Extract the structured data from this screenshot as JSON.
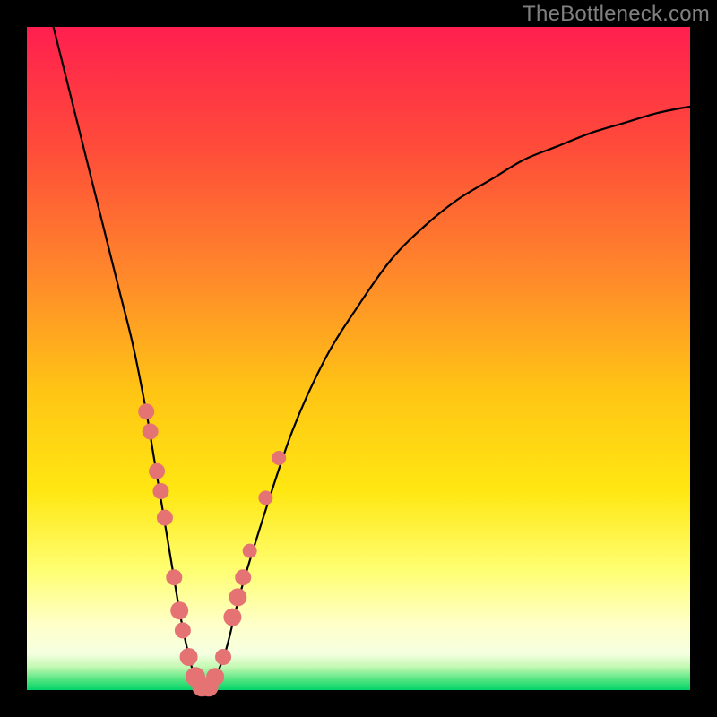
{
  "watermark": "TheBottleneck.com",
  "colors": {
    "frame": "#000000",
    "curve": "#000000",
    "dot_fill": "#e57373",
    "dot_stroke": "#c05858",
    "gradient_stops": [
      {
        "offset": 0.0,
        "color": "#ff1f4f"
      },
      {
        "offset": 0.18,
        "color": "#ff4b3a"
      },
      {
        "offset": 0.38,
        "color": "#ff8a2a"
      },
      {
        "offset": 0.55,
        "color": "#ffc514"
      },
      {
        "offset": 0.7,
        "color": "#ffe712"
      },
      {
        "offset": 0.82,
        "color": "#ffff73"
      },
      {
        "offset": 0.9,
        "color": "#ffffc8"
      },
      {
        "offset": 0.945,
        "color": "#f5ffe0"
      },
      {
        "offset": 0.965,
        "color": "#c3f9b3"
      },
      {
        "offset": 0.985,
        "color": "#4fe47e"
      },
      {
        "offset": 1.0,
        "color": "#00d46a"
      }
    ]
  },
  "chart_data": {
    "type": "line",
    "title": "",
    "xlabel": "",
    "ylabel": "",
    "xlim": [
      0,
      100
    ],
    "ylim": [
      0,
      100
    ],
    "series": [
      {
        "name": "bottleneck-curve",
        "x": [
          4,
          6,
          8,
          10,
          12,
          14,
          16,
          18,
          19,
          20,
          21,
          22,
          23,
          24,
          25,
          26,
          27,
          28,
          30,
          32,
          35,
          40,
          45,
          50,
          55,
          60,
          65,
          70,
          75,
          80,
          85,
          90,
          95,
          100
        ],
        "y": [
          100,
          92,
          84,
          76,
          68,
          60,
          52,
          42,
          36,
          30,
          24,
          18,
          12,
          7,
          3,
          1,
          0,
          1,
          6,
          14,
          24,
          39,
          50,
          58,
          65,
          70,
          74,
          77,
          80,
          82,
          84,
          85.5,
          87,
          88
        ]
      }
    ],
    "markers": [
      {
        "x": 18.0,
        "y": 42,
        "r": 9
      },
      {
        "x": 18.6,
        "y": 39,
        "r": 9
      },
      {
        "x": 19.6,
        "y": 33,
        "r": 9
      },
      {
        "x": 20.2,
        "y": 30,
        "r": 9
      },
      {
        "x": 20.8,
        "y": 26,
        "r": 9
      },
      {
        "x": 22.2,
        "y": 17,
        "r": 9
      },
      {
        "x": 23.0,
        "y": 12,
        "r": 10
      },
      {
        "x": 23.5,
        "y": 9,
        "r": 9
      },
      {
        "x": 24.4,
        "y": 5,
        "r": 10
      },
      {
        "x": 25.4,
        "y": 2,
        "r": 11
      },
      {
        "x": 26.4,
        "y": 0.5,
        "r": 11
      },
      {
        "x": 27.4,
        "y": 0.5,
        "r": 11
      },
      {
        "x": 28.4,
        "y": 2,
        "r": 10
      },
      {
        "x": 29.6,
        "y": 5,
        "r": 9
      },
      {
        "x": 31.0,
        "y": 11,
        "r": 10
      },
      {
        "x": 31.8,
        "y": 14,
        "r": 10
      },
      {
        "x": 32.6,
        "y": 17,
        "r": 9
      },
      {
        "x": 33.6,
        "y": 21,
        "r": 8
      },
      {
        "x": 36.0,
        "y": 29,
        "r": 8
      },
      {
        "x": 38.0,
        "y": 35,
        "r": 8
      }
    ]
  }
}
